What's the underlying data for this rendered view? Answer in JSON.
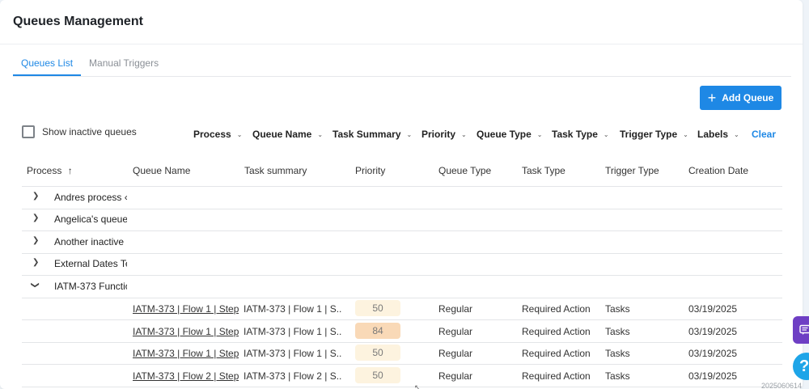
{
  "header": {
    "title": "Queues Management"
  },
  "tabs": [
    {
      "label": "Queues List",
      "active": true
    },
    {
      "label": "Manual Triggers",
      "active": false
    }
  ],
  "actions": {
    "add_queue_label": "Add Queue",
    "add_icon": "plus-icon"
  },
  "checkbox": {
    "label": "Show inactive queues",
    "checked": false
  },
  "filters": {
    "items": [
      "Process",
      "Queue Name",
      "Task Summary",
      "Priority",
      "Queue Type",
      "Task Type",
      "Trigger Type",
      "Labels"
    ],
    "clear_label": "Clear"
  },
  "table": {
    "columns": [
      "Process",
      "Queue Name",
      "Task summary",
      "Priority",
      "Queue Type",
      "Task Type",
      "Trigger Type",
      "Creation Date"
    ],
    "sort_indicator": "↑",
    "groups": [
      {
        "name": "Andres process ‹",
        "expanded": false
      },
      {
        "name": "Angelica's queue",
        "expanded": false
      },
      {
        "name": "Another inactive",
        "expanded": false
      },
      {
        "name": "External Dates Te",
        "expanded": false
      },
      {
        "name": "IATM-373 Functio",
        "expanded": true
      }
    ],
    "rows": [
      {
        "queue_name": "IATM-373 | Flow 1 | Step",
        "task_summary": "IATM-373 | Flow 1 | S...",
        "priority": "50",
        "priority_color": "#fdf3df",
        "queue_type": "Regular",
        "task_type": "Required Action",
        "trigger_type": "Tasks",
        "creation_date": "03/19/2025"
      },
      {
        "queue_name": "IATM-373 | Flow 1 | Step",
        "task_summary": "IATM-373 | Flow 1 | S...",
        "priority": "84",
        "priority_color": "#f9d9b7",
        "queue_type": "Regular",
        "task_type": "Required Action",
        "trigger_type": "Tasks",
        "creation_date": "03/19/2025"
      },
      {
        "queue_name": "IATM-373 | Flow 1 | Step",
        "task_summary": "IATM-373 | Flow 1 | S...",
        "priority": "50",
        "priority_color": "#fdf3df",
        "queue_type": "Regular",
        "task_type": "Required Action",
        "trigger_type": "Tasks",
        "creation_date": "03/19/2025"
      },
      {
        "queue_name": "IATM-373 | Flow 2 | Step",
        "task_summary": "IATM-373 | Flow 2 | S...",
        "priority": "50",
        "priority_color": "#fdf3df",
        "queue_type": "Regular",
        "task_type": "Required Action",
        "trigger_type": "Tasks",
        "creation_date": "03/19/2025"
      }
    ]
  },
  "floating": {
    "chat_icon": "chat-icon",
    "help_icon": "help-icon",
    "help_glyph": "?"
  },
  "footer": {
    "version": "2025060614"
  }
}
